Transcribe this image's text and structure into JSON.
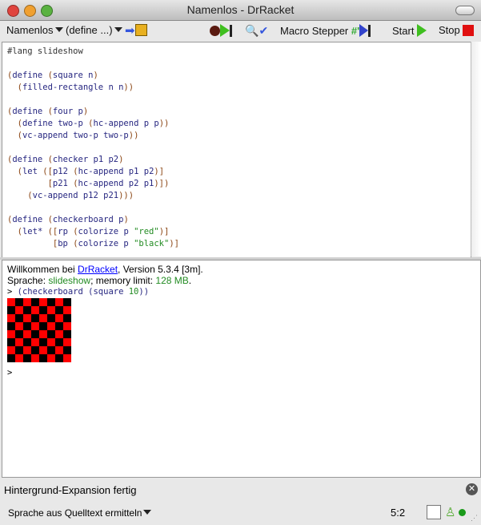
{
  "window": {
    "title": "Namenlos - DrRacket"
  },
  "toolbar": {
    "file_menu": "Namenlos",
    "define_menu": "(define ...)",
    "macro_stepper": "Macro Stepper",
    "start": "Start",
    "stop": "Stop"
  },
  "editor": {
    "lines": [
      [
        [
          "k",
          "#lang slideshow"
        ]
      ],
      [],
      [
        [
          "p",
          "("
        ],
        [
          "i",
          "define "
        ],
        [
          "p",
          "("
        ],
        [
          "i",
          "square n"
        ],
        [
          "p",
          ")"
        ]
      ],
      [
        [
          "k",
          "  "
        ],
        [
          "p",
          "("
        ],
        [
          "i",
          "filled-rectangle n n"
        ],
        [
          "p",
          "))"
        ]
      ],
      [],
      [
        [
          "p",
          "("
        ],
        [
          "i",
          "define "
        ],
        [
          "p",
          "("
        ],
        [
          "i",
          "four p"
        ],
        [
          "p",
          ")"
        ]
      ],
      [
        [
          "k",
          "  "
        ],
        [
          "p",
          "("
        ],
        [
          "i",
          "define two-p "
        ],
        [
          "p",
          "("
        ],
        [
          "i",
          "hc-append p p"
        ],
        [
          "p",
          "))"
        ]
      ],
      [
        [
          "k",
          "  "
        ],
        [
          "p",
          "("
        ],
        [
          "i",
          "vc-append two-p two-p"
        ],
        [
          "p",
          "))"
        ]
      ],
      [],
      [
        [
          "p",
          "("
        ],
        [
          "i",
          "define "
        ],
        [
          "p",
          "("
        ],
        [
          "i",
          "checker p1 p2"
        ],
        [
          "p",
          ")"
        ]
      ],
      [
        [
          "k",
          "  "
        ],
        [
          "p",
          "("
        ],
        [
          "i",
          "let "
        ],
        [
          "p",
          "(["
        ],
        [
          "i",
          "p12 "
        ],
        [
          "p",
          "("
        ],
        [
          "i",
          "hc-append p1 p2"
        ],
        [
          "p",
          ")]"
        ]
      ],
      [
        [
          "k",
          "        "
        ],
        [
          "p",
          "["
        ],
        [
          "i",
          "p21 "
        ],
        [
          "p",
          "("
        ],
        [
          "i",
          "hc-append p2 p1"
        ],
        [
          "p",
          ")])"
        ]
      ],
      [
        [
          "k",
          "    "
        ],
        [
          "p",
          "("
        ],
        [
          "i",
          "vc-append p12 p21"
        ],
        [
          "p",
          ")))"
        ]
      ],
      [],
      [
        [
          "p",
          "("
        ],
        [
          "i",
          "define "
        ],
        [
          "p",
          "("
        ],
        [
          "i",
          "checkerboard p"
        ],
        [
          "p",
          ")"
        ]
      ],
      [
        [
          "k",
          "  "
        ],
        [
          "p",
          "("
        ],
        [
          "i",
          "let* "
        ],
        [
          "p",
          "(["
        ],
        [
          "i",
          "rp "
        ],
        [
          "p",
          "("
        ],
        [
          "i",
          "colorize p "
        ],
        [
          "s",
          "\"red\""
        ],
        [
          "p",
          ")]"
        ]
      ],
      [
        [
          "k",
          "         "
        ],
        [
          "p",
          "["
        ],
        [
          "i",
          "bp "
        ],
        [
          "p",
          "("
        ],
        [
          "i",
          "colorize p "
        ],
        [
          "s",
          "\"black\""
        ],
        [
          "p",
          ")]"
        ]
      ]
    ]
  },
  "repl": {
    "welcome_prefix": "Willkommen bei ",
    "welcome_link": "DrRacket",
    "welcome_suffix": ", Version 5.3.4 [3m].",
    "lang_prefix": "Sprache: ",
    "lang_name": "slideshow",
    "lang_mid": "; memory limit: ",
    "memory": "128 MB",
    "lang_end": ".",
    "prompt": ">",
    "input_open": "(checkerboard (square ",
    "input_num": "10",
    "input_close": "))",
    "result": {
      "rows": 8,
      "cols": 8,
      "colors": [
        "#ff0000",
        "#000000"
      ]
    },
    "prompt2": ">"
  },
  "status": {
    "message": "Hintergrund-Expansion fertig",
    "language_menu": "Sprache aus Quelltext ermitteln",
    "position": "5:2"
  }
}
